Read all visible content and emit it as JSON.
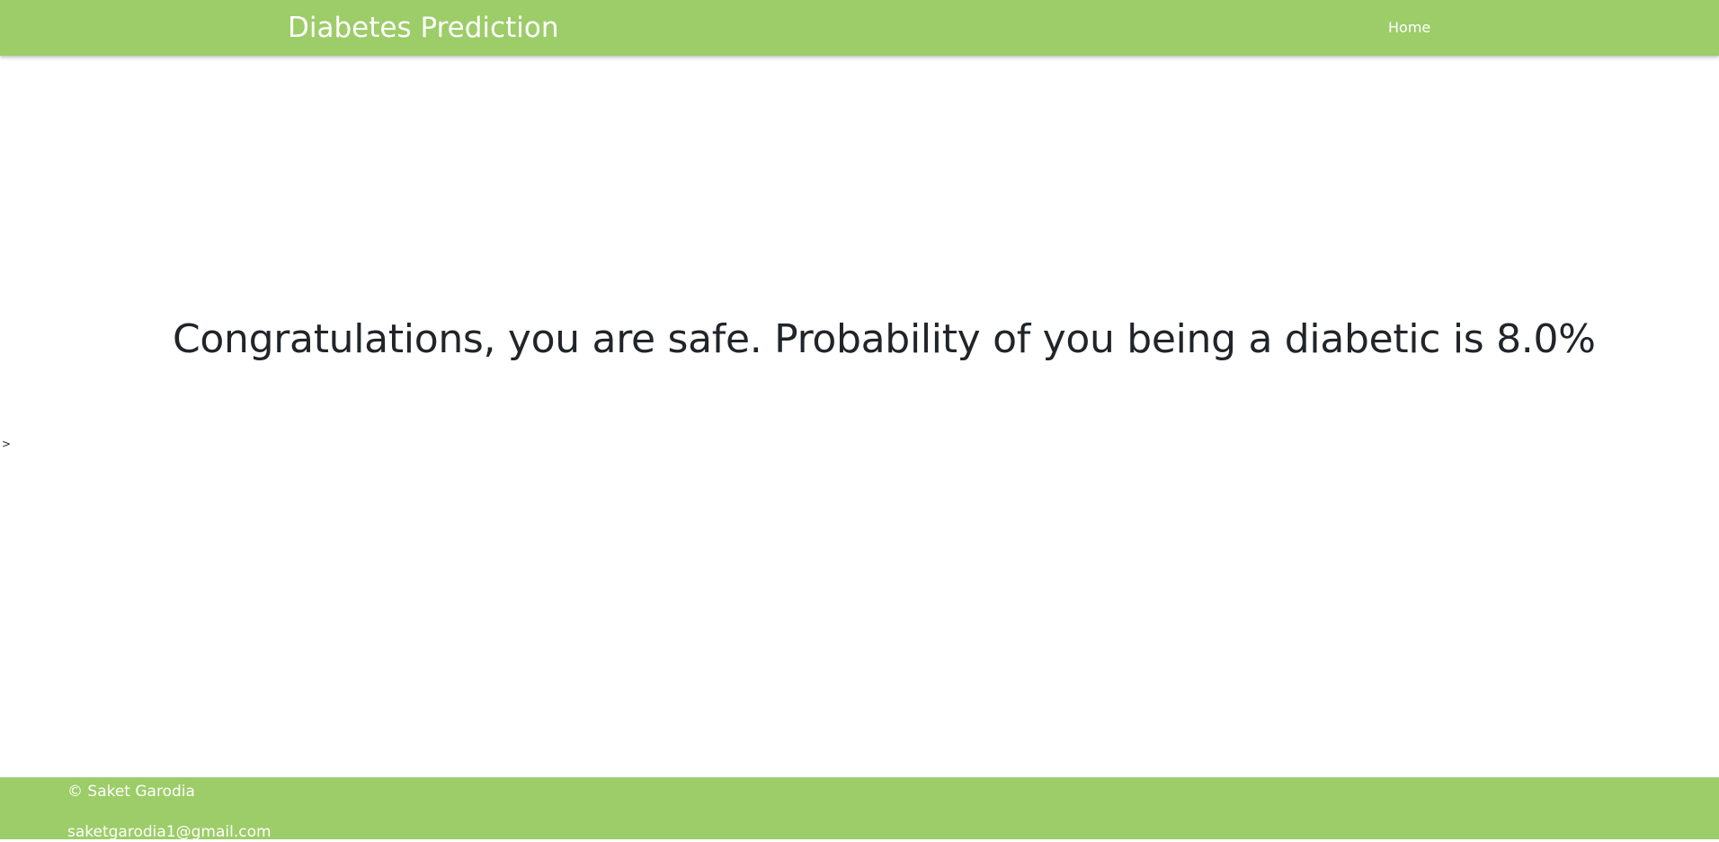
{
  "navbar": {
    "brand": "Diabetes Prediction",
    "home_link": "Home"
  },
  "main": {
    "result_message": "Congratulations, you are safe. Probability of you being a diabetic is 8.0%",
    "stray_text": ">"
  },
  "footer": {
    "copyright": "© Saket Garodia",
    "email": "saketgarodia1@gmail.com"
  },
  "colors": {
    "navbar_bg": "#9ccd68",
    "footer_bg": "#9ccd68",
    "text": "#212529",
    "nav_text": "#ffffff"
  }
}
